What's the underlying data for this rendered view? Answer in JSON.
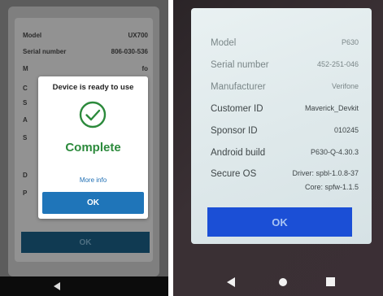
{
  "left_device": {
    "rows": [
      {
        "label": "Model",
        "value": "UX700"
      },
      {
        "label": "Serial number",
        "value": "806-030-536"
      },
      {
        "label": "M",
        "value": "fo"
      },
      {
        "label": "C",
        "value": ""
      },
      {
        "label": "S",
        "value": "5"
      },
      {
        "label": "A",
        "value": "0"
      },
      {
        "label": "S",
        "value": "0"
      },
      {
        "label": "",
        "value": "1"
      },
      {
        "label": "",
        "value": "1"
      },
      {
        "label": "D",
        "value": "0"
      },
      {
        "label": "P",
        "value": "0"
      }
    ],
    "ok_label": "OK",
    "dialog": {
      "title": "Device is ready to use",
      "status": "Complete",
      "more_info": "More info",
      "ok_label": "OK"
    },
    "colors": {
      "check": "#2c8a3c",
      "ok_button": "#1f75b9",
      "link": "#1f6fb4"
    }
  },
  "right_device": {
    "rows": [
      {
        "label": "Model",
        "value": "P630"
      },
      {
        "label": "Serial number",
        "value": "452-251-046"
      },
      {
        "label": "Manufacturer",
        "value": "Verifone"
      },
      {
        "label": "Customer ID",
        "value": "Maverick_Devkit"
      },
      {
        "label": "Sponsor ID",
        "value": "010245"
      },
      {
        "label": "Android build",
        "value": "P630-Q-4.30.3"
      },
      {
        "label": "Secure OS",
        "value": "Driver: spbl-1.0.8-37"
      }
    ],
    "secure_os_core": "Core: spfw-1.1.5",
    "ok_label": "OK",
    "colors": {
      "ok_button": "#1b4fd6"
    }
  },
  "icons": [
    "check-circle-icon",
    "back-icon",
    "home-icon",
    "recent-apps-icon"
  ]
}
